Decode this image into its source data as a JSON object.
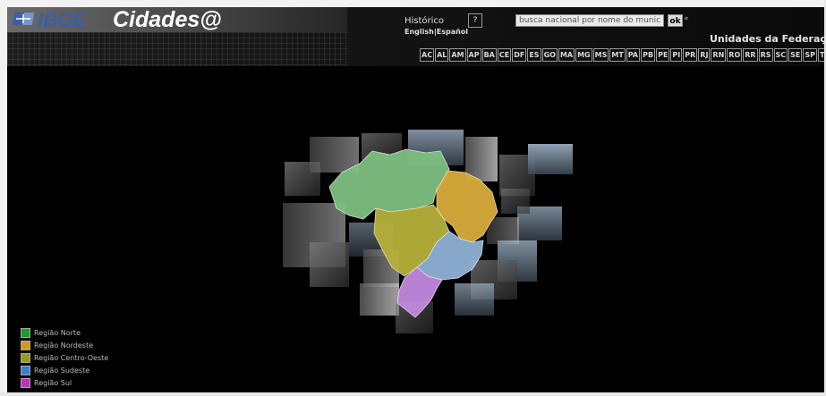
{
  "brand": {
    "ibge": "IBGE",
    "cidades": "Cidades@"
  },
  "nav": {
    "historico": "Histórico",
    "help": "?",
    "english": "English",
    "separator": "|",
    "espanol": "Español"
  },
  "search": {
    "value": "busca nacional por nome do município",
    "ok_label": "ok",
    "extra": "«"
  },
  "ufs": {
    "title": "Unidades da Federação",
    "items": [
      "AC",
      "AL",
      "AM",
      "AP",
      "BA",
      "CE",
      "DF",
      "ES",
      "GO",
      "MA",
      "MG",
      "MS",
      "MT",
      "PA",
      "PB",
      "PE",
      "PI",
      "PR",
      "RJ",
      "RN",
      "RO",
      "RR",
      "RS",
      "SC",
      "SE",
      "SP",
      "TO"
    ]
  },
  "legend": {
    "items": [
      {
        "label": "Região Norte",
        "color": "#1f9a2e"
      },
      {
        "label": "Região Nordeste",
        "color": "#d59a1a"
      },
      {
        "label": "Região Centro-Oeste",
        "color": "#9a9a18"
      },
      {
        "label": "Região Sudeste",
        "color": "#3a7fd0"
      },
      {
        "label": "Região Sul",
        "color": "#c42ec4"
      }
    ]
  },
  "map": {
    "region_colors": {
      "norte": "#7fbf82",
      "nordeste": "#d8ac3a",
      "centro_oeste": "#b7b03a",
      "sudeste": "#8fb2d6",
      "sul": "#c28adf"
    }
  }
}
